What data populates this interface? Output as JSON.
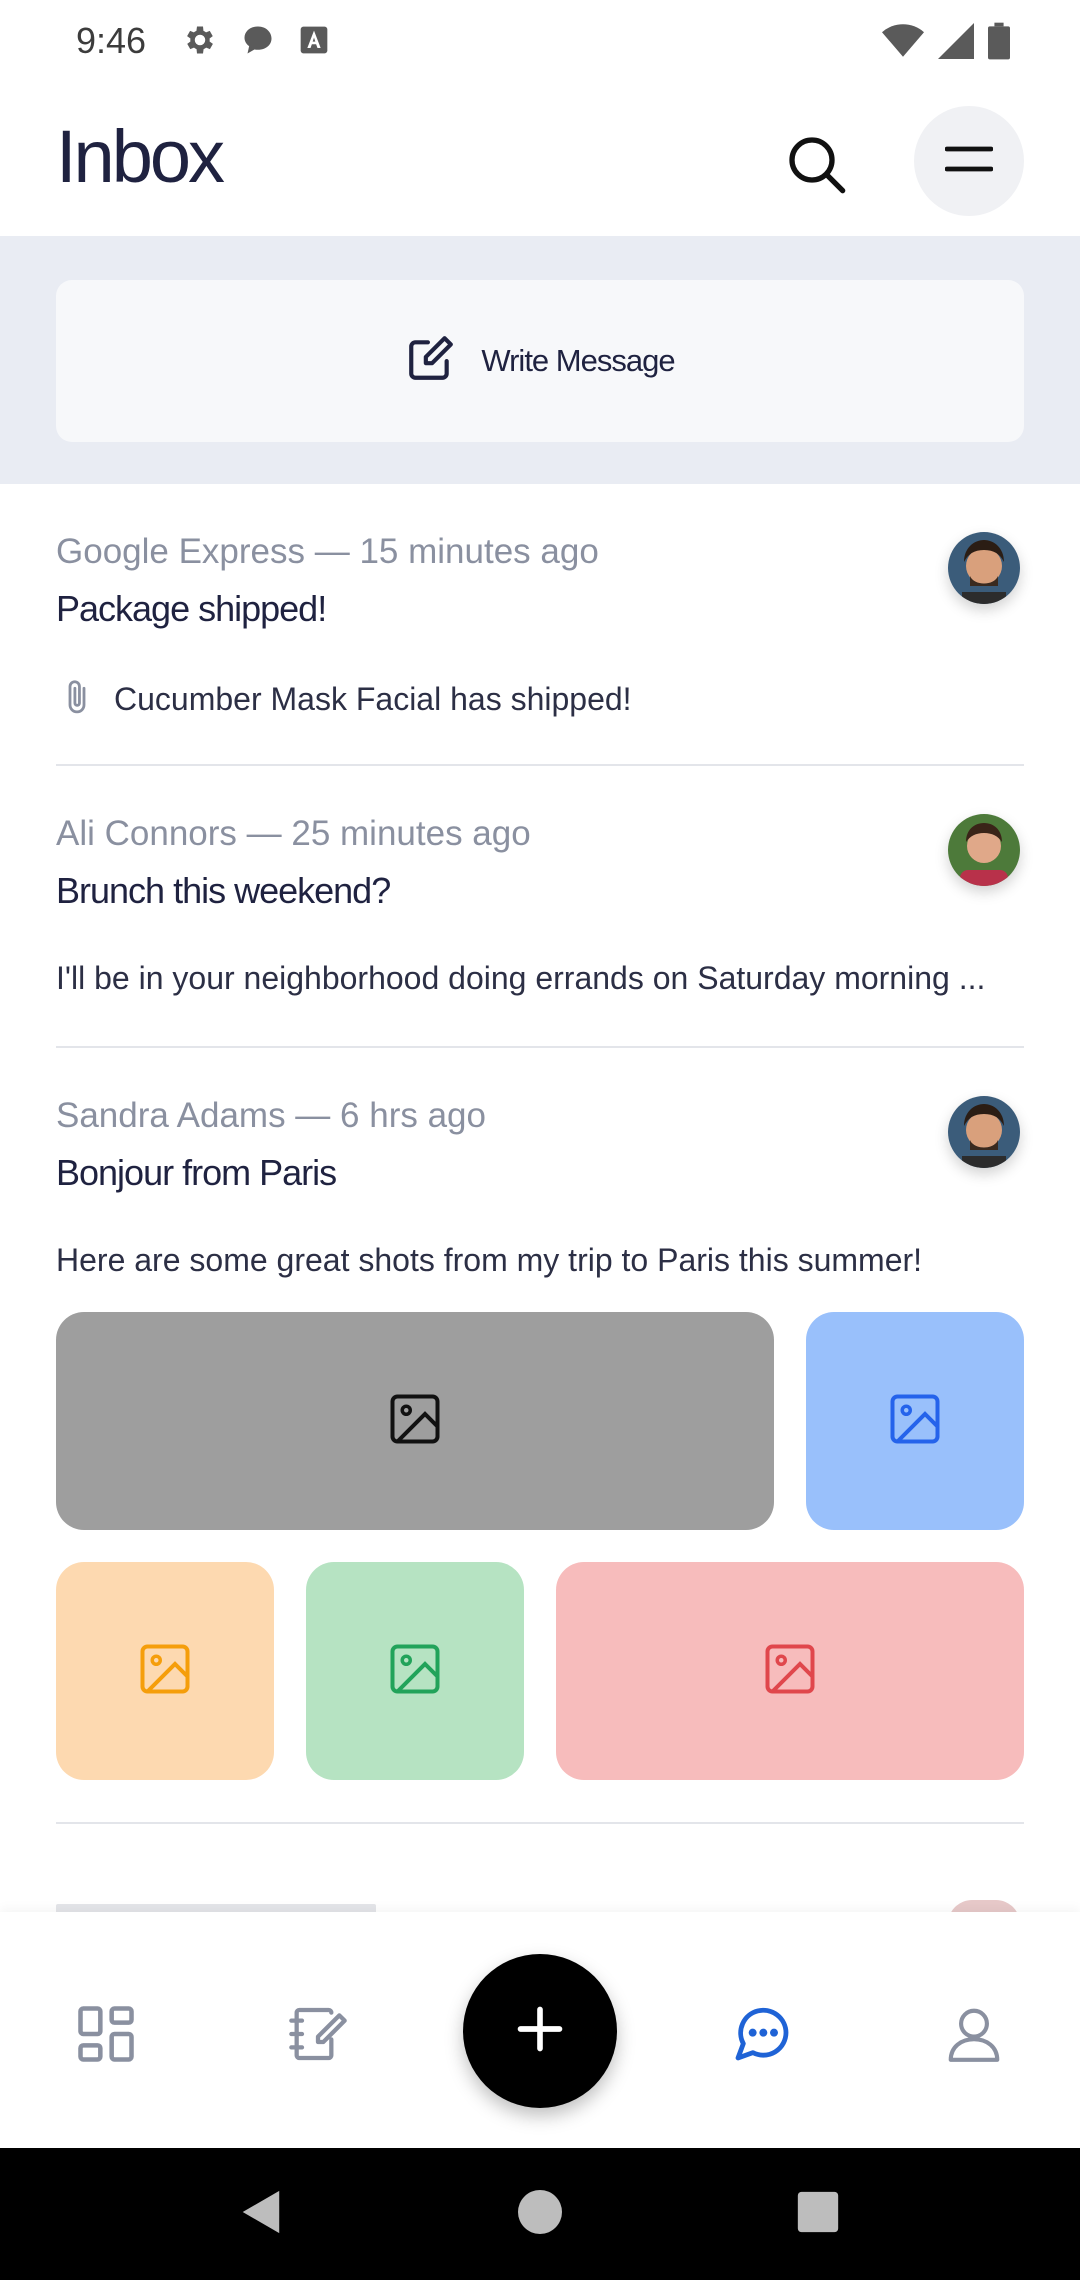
{
  "status_bar": {
    "time": "9:46",
    "left_icons": [
      "settings-icon",
      "chat-bubble-icon",
      "font-a-icon"
    ],
    "right_icons": [
      "wifi-icon",
      "cell-signal-icon",
      "battery-icon"
    ]
  },
  "header": {
    "title": "Inbox",
    "search_icon": "search-icon",
    "menu_icon": "menu-icon"
  },
  "compose": {
    "label": "Write Message",
    "icon": "compose-icon"
  },
  "messages": [
    {
      "meta": "Google Express — 15 minutes ago",
      "subject": "Package shipped!",
      "preview": "Cucumber Mask Facial has shipped!",
      "has_attachment": true
    },
    {
      "meta": "Ali Connors — 25 minutes ago",
      "subject": "Brunch this weekend?",
      "preview": "I'll be in your neighborhood doing errands on Saturday morning ..."
    },
    {
      "meta": "Sandra Adams — 6 hrs ago",
      "subject": "Bonjour from Paris",
      "preview": "Here are some great shots from my trip to Paris this summer!",
      "photo_colors": [
        "#9e9e9e",
        "#99c0fb",
        "#fdd9b0",
        "#b6e3c2",
        "#f7bcbc"
      ]
    }
  ],
  "bottom_nav": {
    "items": [
      "dashboard-icon",
      "notes-icon",
      "add-icon",
      "messages-icon",
      "profile-icon"
    ],
    "active": "messages-icon",
    "accent": "#1f63d6"
  },
  "system_nav": [
    "back-icon",
    "home-icon",
    "recents-icon"
  ]
}
